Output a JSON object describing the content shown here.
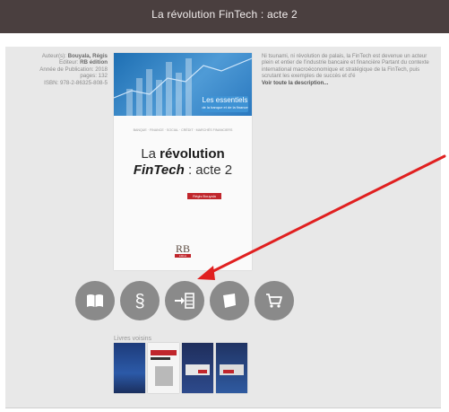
{
  "header": {
    "title": "La révolution FinTech : acte 2"
  },
  "meta": {
    "author_label": "Auteur(s):",
    "author_value": "Bouyala, Régis",
    "editor_label": "Editeur:",
    "editor_value": "RB édition",
    "year_label": "Année de Publication:",
    "year_value": "2018",
    "pages_label": "pages:",
    "pages_value": "132",
    "isbn_label": "ISBN:",
    "isbn_value": "978-2-86325-808-5"
  },
  "description": {
    "text": "Ni tsunami, ni révolution de palais, la FinTech est devenue un acteur plein et entier de l'industrie bancaire et financière Partant du contexte international macroéconomique et stratégique de la FinTech, puis scrutant les exemples de succès et d'é",
    "more_link": "Voir toute la description..."
  },
  "cover": {
    "badge": "Les essentiels",
    "badge_sub": "de la banque et de la finance",
    "tags": "BANQUE · FINANCE · SOCIAL · CRÉDIT · MARCHÉS FINANCIERS",
    "title_a": "La ",
    "title_b": "révolution",
    "title_c": "FinTech",
    "title_d": " : acte 2",
    "author": "Régis Bouyala",
    "logo": "RB",
    "logo_sub": "édition"
  },
  "actions": [
    {
      "name": "read-button",
      "icon": "book-icon"
    },
    {
      "name": "legal-button",
      "icon": "section-icon"
    },
    {
      "name": "table-of-contents-button",
      "icon": "toc-icon"
    },
    {
      "name": "excerpt-button",
      "icon": "page-icon"
    },
    {
      "name": "buy-button",
      "icon": "cart-icon"
    }
  ],
  "neighbors": {
    "label": "Livres voisins"
  },
  "colors": {
    "topbar": "#4a3f3f",
    "panel": "#e8e8e8",
    "button": "#8a8a8a",
    "arrow": "#e02020",
    "cover_blue": "#2a78bf",
    "cover_red": "#c0262c"
  }
}
